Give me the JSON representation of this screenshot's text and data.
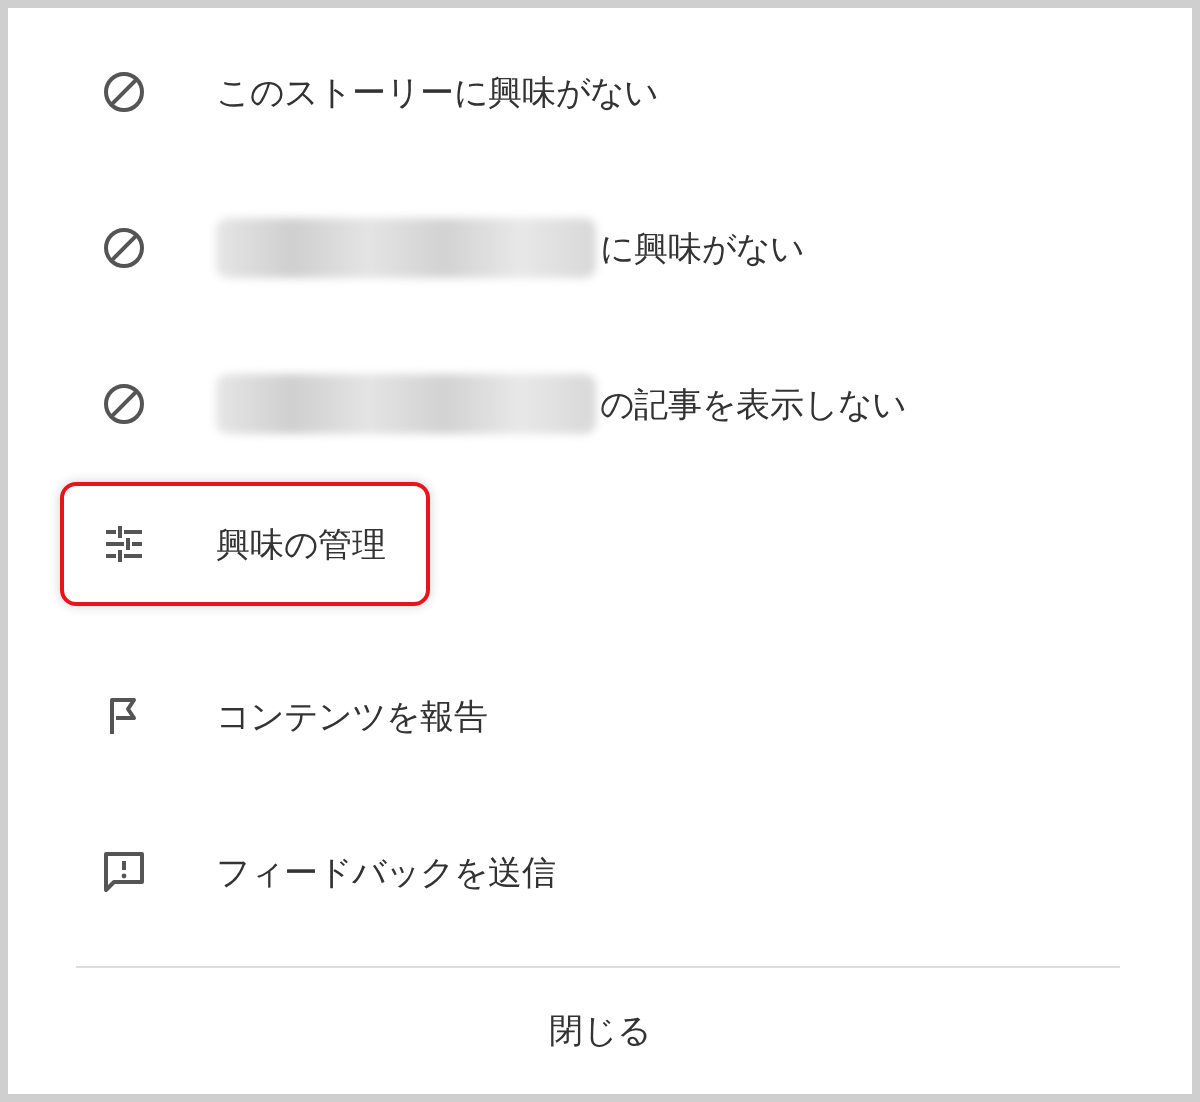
{
  "menu": {
    "items": [
      {
        "kind": "block",
        "label": "このストーリーに興味がない",
        "redacted": false,
        "highlighted": false
      },
      {
        "kind": "block",
        "label": "に興味がない",
        "redacted": true,
        "highlighted": false
      },
      {
        "kind": "block",
        "label": "の記事を表示しない",
        "redacted": true,
        "highlighted": false
      },
      {
        "kind": "tune",
        "label": "興味の管理",
        "redacted": false,
        "highlighted": true
      },
      {
        "kind": "flag",
        "label": "コンテンツを報告",
        "redacted": false,
        "highlighted": false
      },
      {
        "kind": "feedback",
        "label": "フィードバックを送信",
        "redacted": false,
        "highlighted": false
      }
    ],
    "close_button": "閉じる"
  }
}
